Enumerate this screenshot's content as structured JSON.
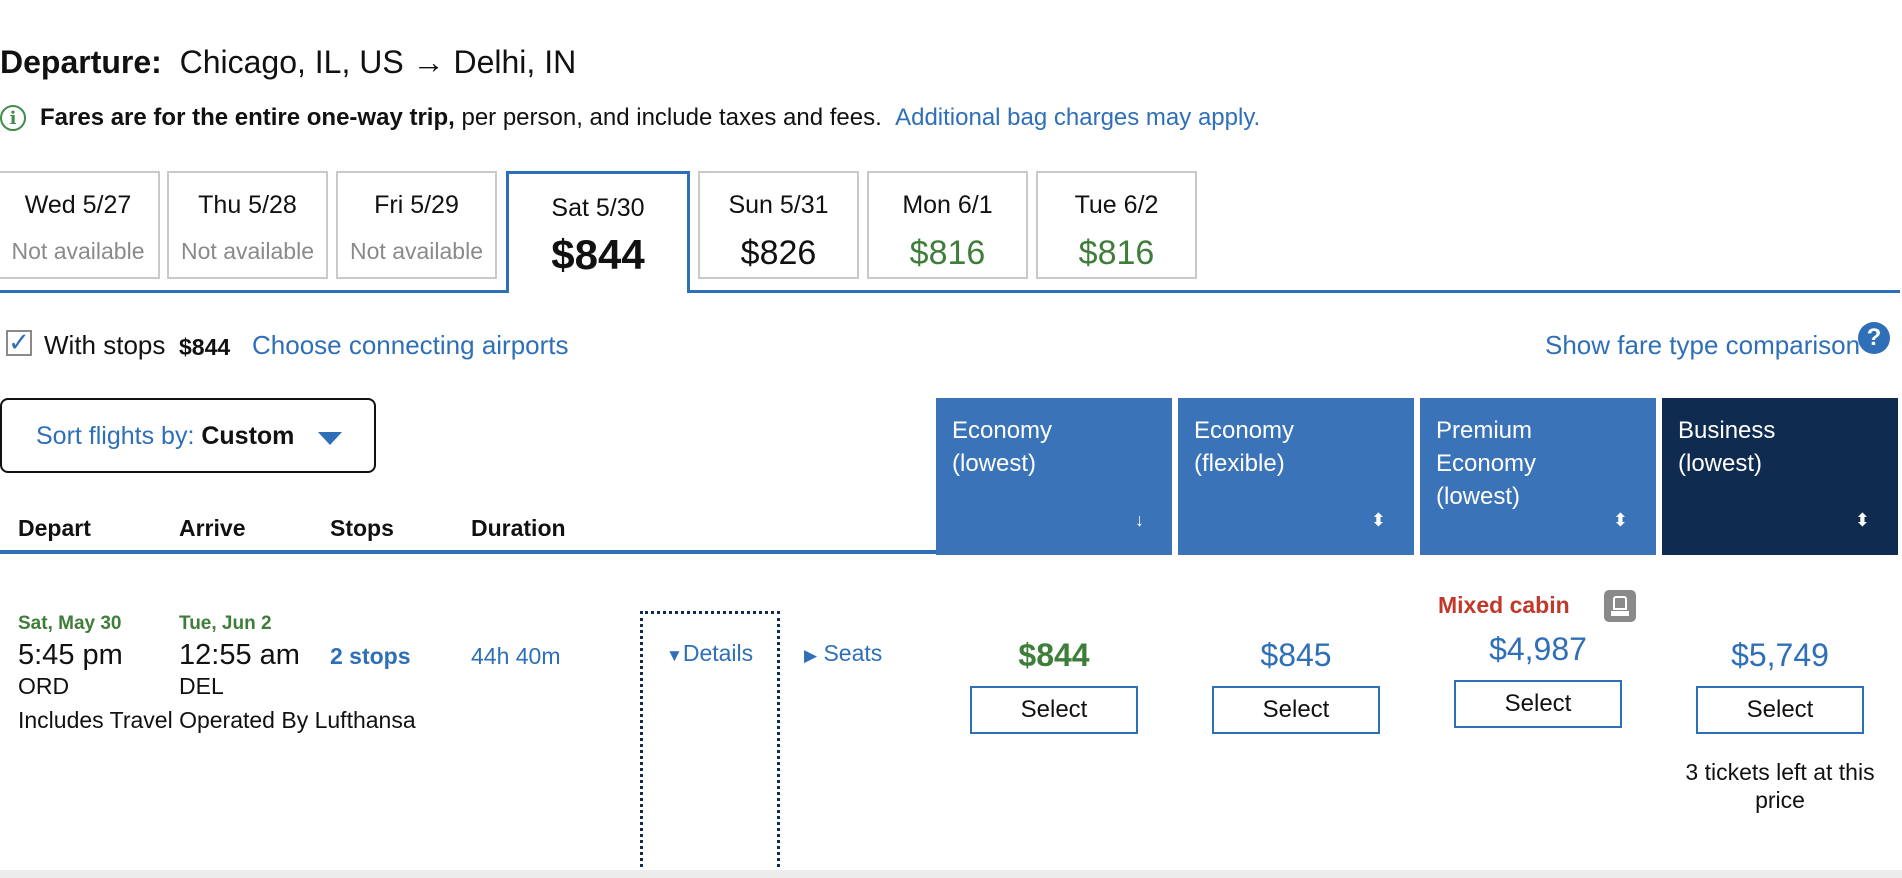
{
  "header": {
    "departure_label": "Departure:",
    "route": "Chicago, IL, US → Delhi, IN",
    "info_bold": "Fares are for the entire one-way trip,",
    "info_rest": "per person, and include taxes and fees.",
    "bag_link": "Additional bag charges may apply."
  },
  "date_tabs": [
    {
      "date": "Wed 5/27",
      "price": "Not available"
    },
    {
      "date": "Thu 5/28",
      "price": "Not available"
    },
    {
      "date": "Fri 5/29",
      "price": "Not available"
    },
    {
      "date": "Sat 5/30",
      "price": "$844"
    },
    {
      "date": "Sun 5/31",
      "price": "$826"
    },
    {
      "date": "Mon 6/1",
      "price": "$816"
    },
    {
      "date": "Tue 6/2",
      "price": "$816"
    }
  ],
  "filters": {
    "with_stops_label": "With stops",
    "with_stops_price": "$844",
    "with_stops_checked": true,
    "connecting_link": "Choose connecting airports",
    "fare_compare_link": "Show fare type comparison",
    "help_icon": "?"
  },
  "sort": {
    "label": "Sort flights by:",
    "value": "Custom"
  },
  "columns": {
    "depart": "Depart",
    "arrive": "Arrive",
    "stops": "Stops",
    "duration": "Duration"
  },
  "cabins": [
    {
      "line1": "Economy",
      "line2": "(lowest)",
      "line3": "",
      "sort": "↓"
    },
    {
      "line1": "Economy",
      "line2": "(flexible)",
      "line3": "",
      "sort": "⬍"
    },
    {
      "line1": "Premium",
      "line2": "Economy",
      "line3": "(lowest)",
      "sort": "⬍"
    },
    {
      "line1": "Business",
      "line2": "(lowest)",
      "line3": "",
      "sort": "⬍"
    }
  ],
  "flight": {
    "depart_date": "Sat, May 30",
    "depart_time": "5:45 pm",
    "depart_code": "ORD",
    "arrive_date": "Tue, Jun 2",
    "arrive_time": "12:55 am",
    "arrive_code": "DEL",
    "stops": "2 stops",
    "duration": "44h 40m",
    "operated_by": "Includes Travel Operated By Lufthansa",
    "details_link": "Details",
    "seats_link": "Seats",
    "mixed_cabin": "Mixed cabin",
    "fares": [
      {
        "price": "$844",
        "button": "Select"
      },
      {
        "price": "$845",
        "button": "Select"
      },
      {
        "price": "$4,987",
        "button": "Select"
      },
      {
        "price": "$5,749",
        "button": "Select"
      }
    ],
    "tickets_left": "3 tickets left at this price"
  },
  "colors": {
    "accent": "#2f6fb8",
    "cabin_header": "#3b73b9",
    "business_header": "#0f2b50",
    "lowest_price_green": "#3f7e3a",
    "mixed_cabin_red": "#c0392b"
  }
}
